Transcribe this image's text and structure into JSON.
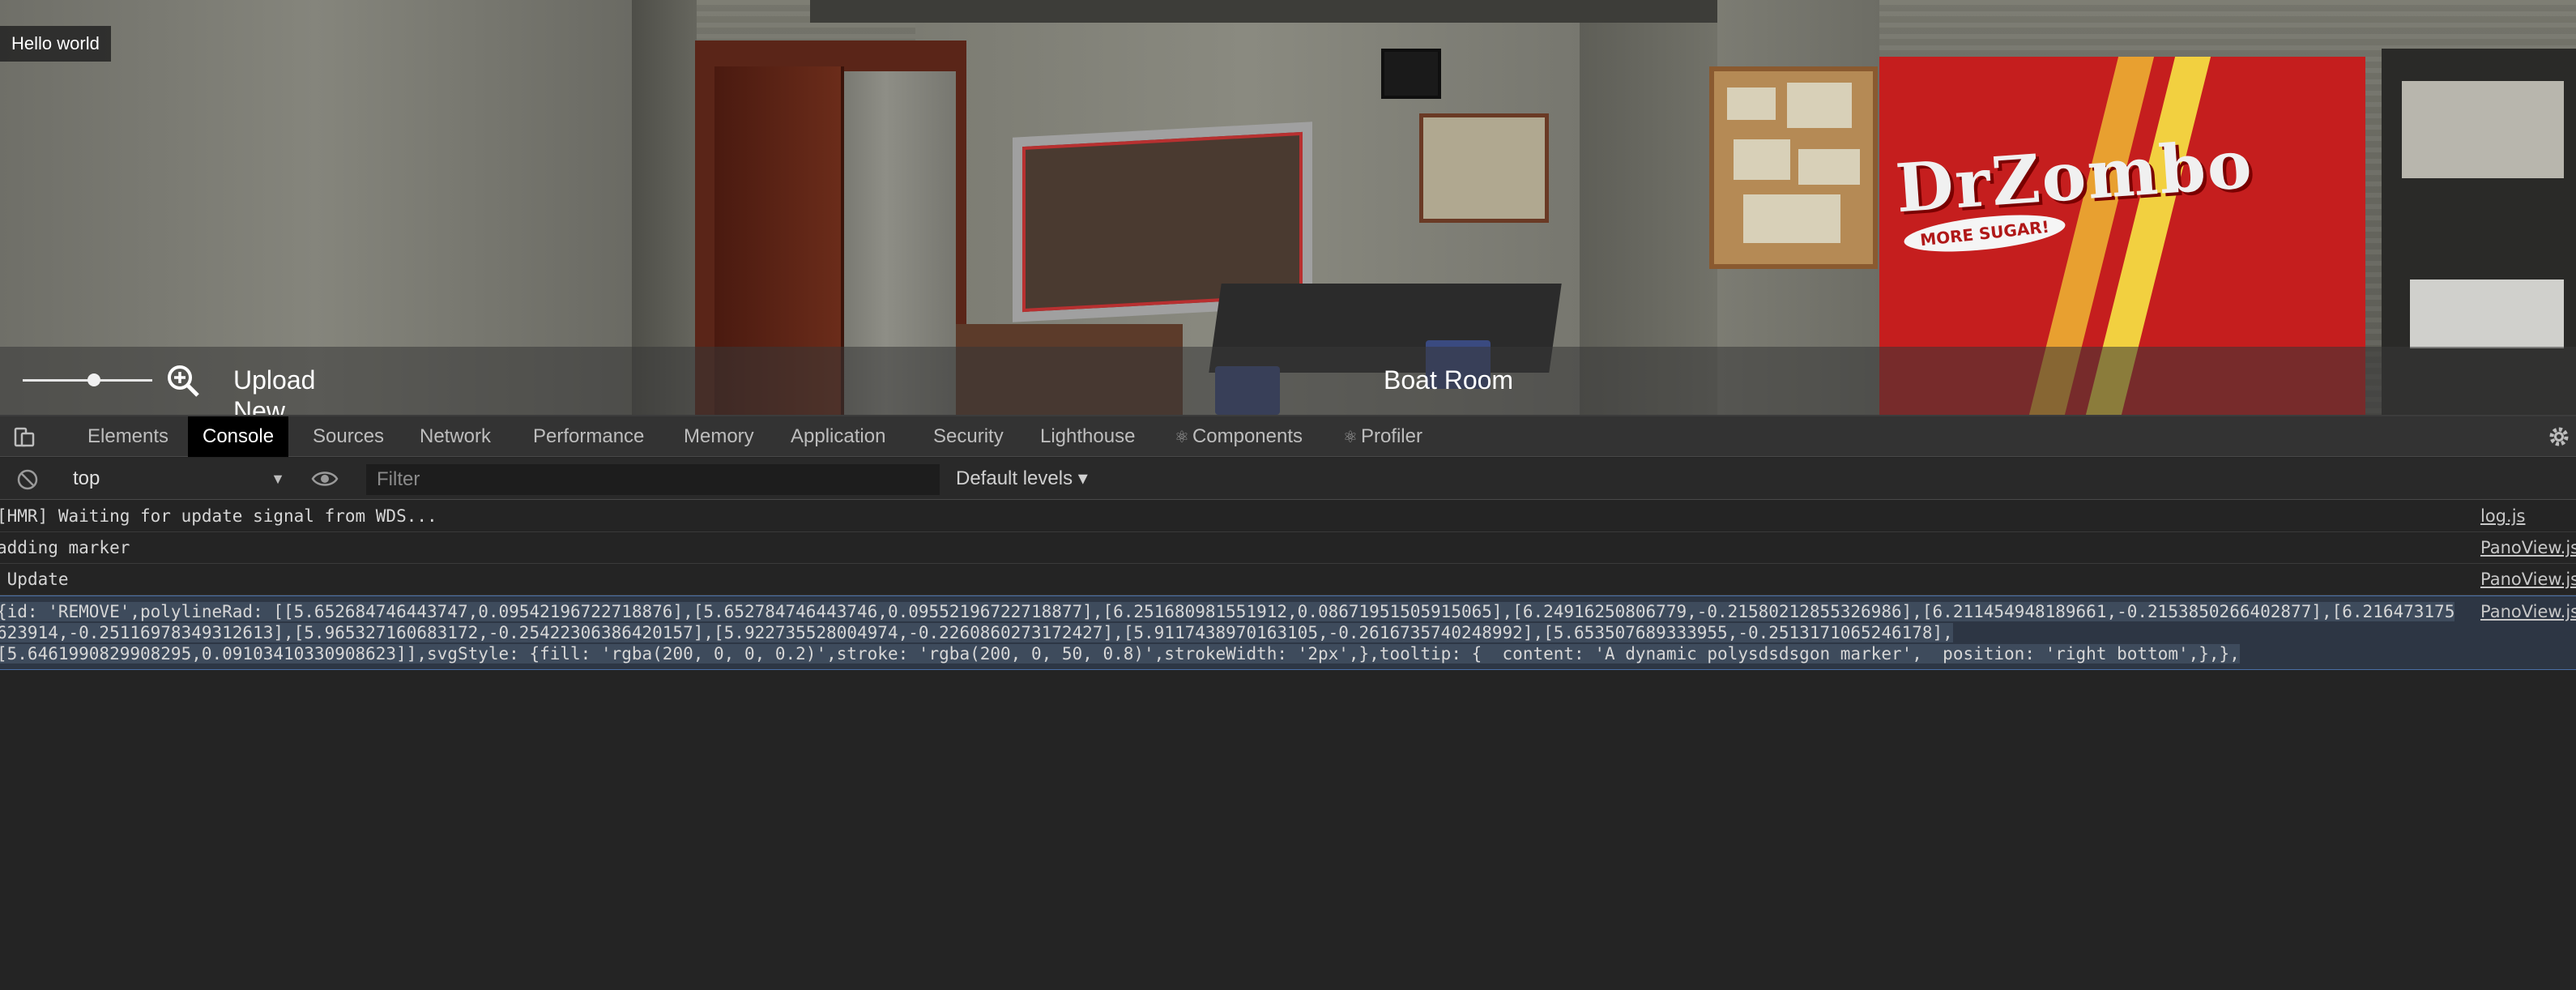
{
  "viewer": {
    "badge_text": "Hello world",
    "upload_label": "Upload New",
    "caption": "Boat Room",
    "zoom_level": 0.55,
    "poster_title": "DrZombo",
    "poster_badge": "MORE SUGAR!"
  },
  "devtools": {
    "tabs": [
      {
        "label": "Elements",
        "active": false,
        "dot": false
      },
      {
        "label": "Console",
        "active": true,
        "dot": false
      },
      {
        "label": "Sources",
        "active": false,
        "dot": false
      },
      {
        "label": "Network",
        "active": false,
        "dot": false
      },
      {
        "label": "Performance",
        "active": false,
        "dot": false
      },
      {
        "label": "Memory",
        "active": false,
        "dot": false
      },
      {
        "label": "Application",
        "active": false,
        "dot": false
      },
      {
        "label": "Security",
        "active": false,
        "dot": false
      },
      {
        "label": "Lighthouse",
        "active": false,
        "dot": false
      },
      {
        "label": "Components",
        "active": false,
        "dot": true
      },
      {
        "label": "Profiler",
        "active": false,
        "dot": true
      }
    ],
    "toolbar": {
      "context": "top",
      "filter_placeholder": "Filter",
      "levels": "Default levels ▾"
    },
    "messages": [
      {
        "text": "[HMR] Waiting for update signal from WDS...",
        "source": "log.js",
        "selected": false
      },
      {
        "text": "adding marker",
        "source": "PanoView.js",
        "selected": false
      },
      {
        "text": " Update",
        "source": "PanoView.js",
        "selected": false
      },
      {
        "text": "{id: 'REMOVE',polylineRad: [[5.652684746443747,0.09542196722718876],[5.652784746443746,0.09552196722718877],[6.251680981551912,0.08671951505915065],[6.24916250806779,-0.21580212855326986],[6.211454948189661,-0.2153850266402877],[6.216473175623914,-0.25116978349312613],[5.965327160683172,-0.25422306386420157],[5.922735528004974,-0.2260860273172427],[5.9117438970163105,-0.2616735740248992],[5.653507689333955,-0.2513171065246178],\n[5.6461990829908295,0.09103410330908623]],svgStyle: {fill: 'rgba(200, 0, 0, 0.2)',stroke: 'rgba(200, 0, 50, 0.8)',strokeWidth: '2px',},tooltip: {  content: 'A dynamic polysdsdsgon marker',  position: 'right bottom',},},",
        "source": "PanoView.js",
        "selected": true
      }
    ]
  },
  "colors": {
    "devtools_bg": "#242424",
    "tabbar_bg": "#333333",
    "active_tab_bg": "#000000",
    "selected_row": "#2d3644",
    "poster_red": "#c51e1e"
  },
  "icons": [
    "zoom-out-icon",
    "zoom-in-icon",
    "device-toggle-icon",
    "clear-console-icon",
    "eye-icon",
    "gear-icon"
  ]
}
